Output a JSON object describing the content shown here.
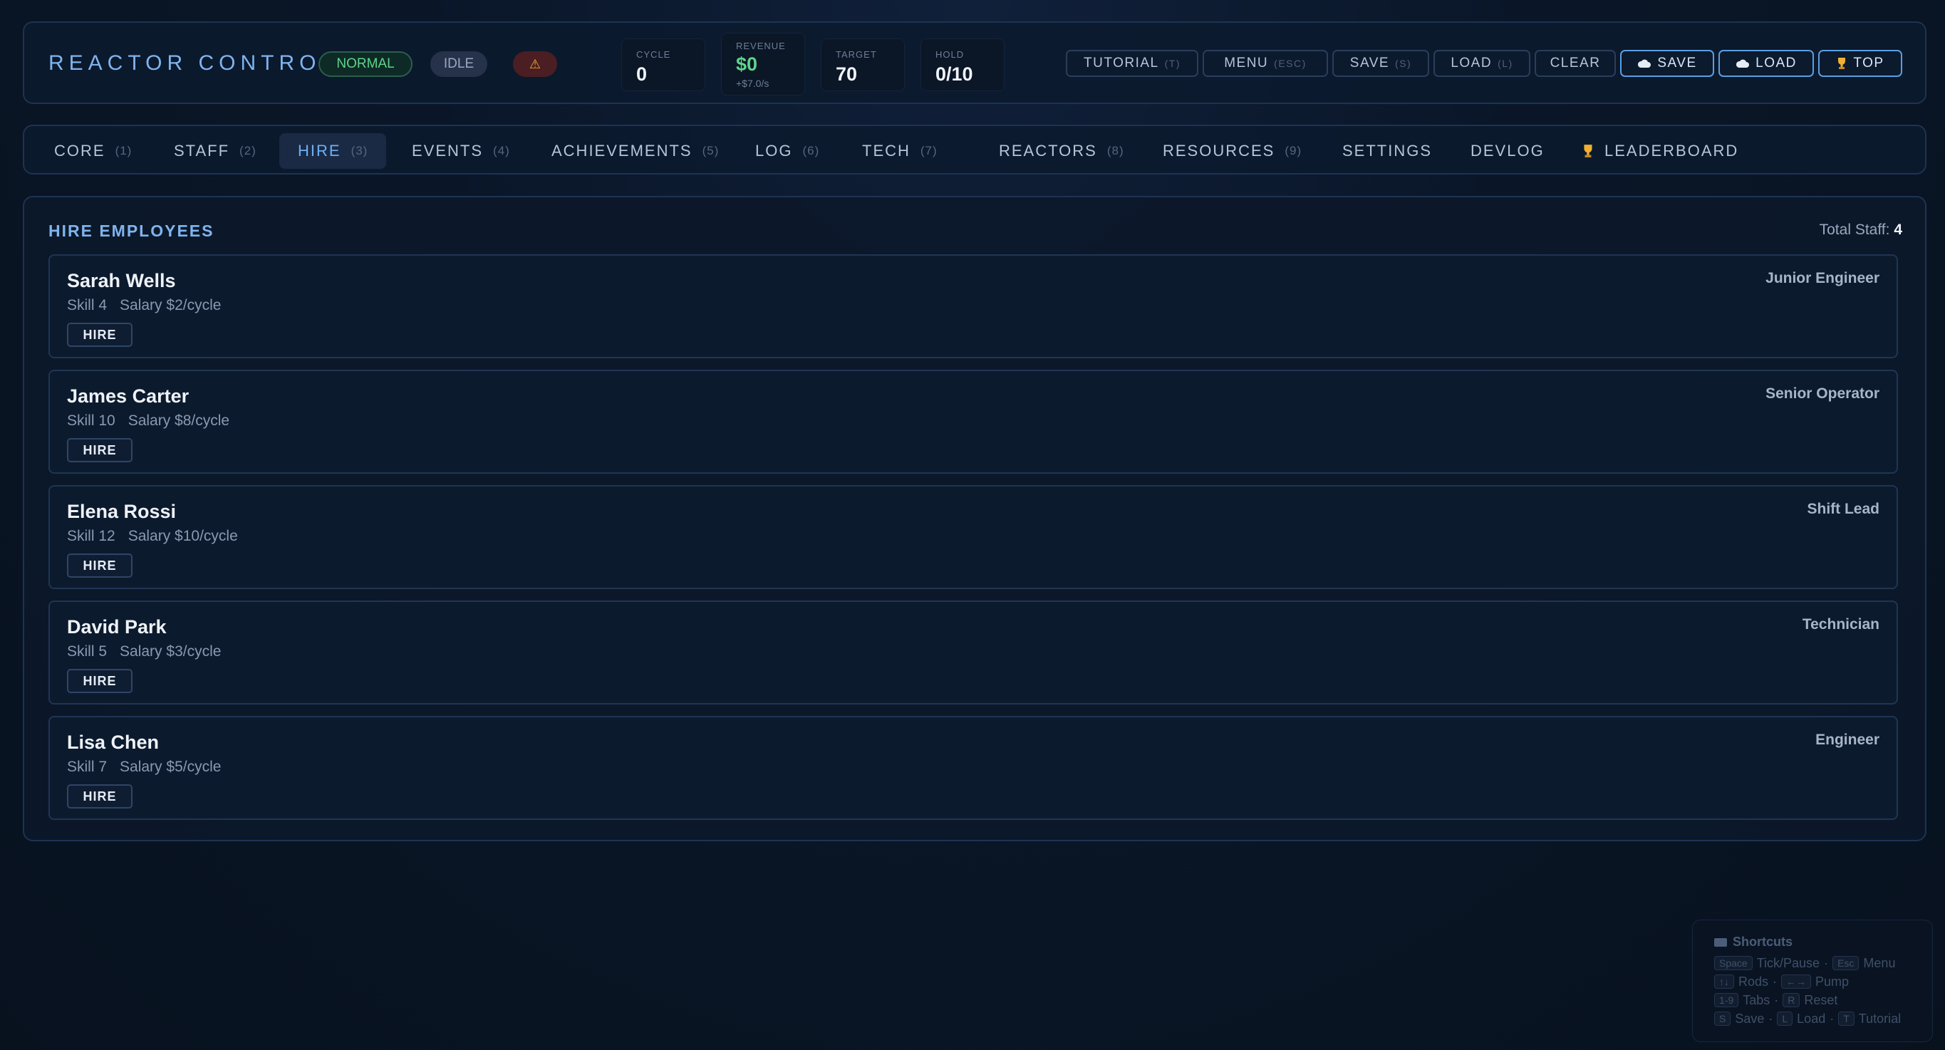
{
  "header": {
    "brand": "REACTOR CONTROL",
    "status_normal": "NORMAL",
    "status_idle": "IDLE",
    "warning_glyph": "⚠",
    "stats": {
      "cycle": {
        "label": "CYCLE",
        "value": "0"
      },
      "revenue": {
        "label": "REVENUE",
        "value": "$0",
        "sub": "+$7.0/s"
      },
      "target": {
        "label": "TARGET",
        "value": "70"
      },
      "hold": {
        "label": "HOLD",
        "value": "0/10"
      }
    },
    "buttons": {
      "tutorial": {
        "label": "TUTORIAL",
        "key": "(T)"
      },
      "menu": {
        "label": "MENU",
        "key": "(ESC)"
      },
      "save": {
        "label": "SAVE",
        "key": "(S)"
      },
      "load": {
        "label": "LOAD",
        "key": "(L)"
      },
      "clear": {
        "label": "CLEAR"
      },
      "cloud_save": {
        "label": "SAVE",
        "icon": "cloud-icon"
      },
      "cloud_load": {
        "label": "LOAD",
        "icon": "cloud-icon"
      },
      "top": {
        "label": "TOP",
        "icon": "trophy-icon"
      }
    }
  },
  "tabs": [
    {
      "label": "CORE",
      "key": "(1)"
    },
    {
      "label": "STAFF",
      "key": "(2)"
    },
    {
      "label": "HIRE",
      "key": "(3)",
      "active": true
    },
    {
      "label": "EVENTS",
      "key": "(4)"
    },
    {
      "label": "ACHIEVEMENTS",
      "key": "(5)"
    },
    {
      "label": "LOG",
      "key": "(6)"
    },
    {
      "label": "TECH",
      "key": "(7)"
    },
    {
      "label": "REACTORS",
      "key": "(8)"
    },
    {
      "label": "RESOURCES",
      "key": "(9)"
    },
    {
      "label": "SETTINGS"
    },
    {
      "label": "DEVLOG"
    },
    {
      "label": "LEADERBOARD",
      "icon": "trophy-icon"
    }
  ],
  "hire": {
    "title": "HIRE EMPLOYEES",
    "total_label": "Total Staff:",
    "total_value": "4",
    "hire_label": "HIRE",
    "candidates": [
      {
        "name": "Sarah Wells",
        "skill": "Skill 4",
        "salary": "Salary $2/cycle",
        "role": "Junior Engineer"
      },
      {
        "name": "James Carter",
        "skill": "Skill 10",
        "salary": "Salary $8/cycle",
        "role": "Senior Operator"
      },
      {
        "name": "Elena Rossi",
        "skill": "Skill 12",
        "salary": "Salary $10/cycle",
        "role": "Shift Lead"
      },
      {
        "name": "David Park",
        "skill": "Skill 5",
        "salary": "Salary $3/cycle",
        "role": "Technician"
      },
      {
        "name": "Lisa Chen",
        "skill": "Skill 7",
        "salary": "Salary $5/cycle",
        "role": "Engineer"
      }
    ]
  },
  "shortcuts": {
    "title": "Shortcuts",
    "rows": [
      [
        {
          "k": "Space",
          "t": "Tick/Pause"
        },
        {
          "k": "Esc",
          "t": "Menu"
        }
      ],
      [
        {
          "k": "↑↓",
          "t": "Rods"
        },
        {
          "k": "←→",
          "t": "Pump"
        }
      ],
      [
        {
          "k": "1-9",
          "t": "Tabs"
        },
        {
          "k": "R",
          "t": "Reset"
        }
      ],
      [
        {
          "k": "S",
          "t": "Save"
        },
        {
          "k": "L",
          "t": "Load"
        },
        {
          "k": "T",
          "t": "Tutorial"
        }
      ]
    ]
  },
  "colors": {
    "accent": "#7fb4ee",
    "active_tab": "#6fb0f4",
    "positive": "#5fd38a",
    "warning": "#f0b030"
  }
}
